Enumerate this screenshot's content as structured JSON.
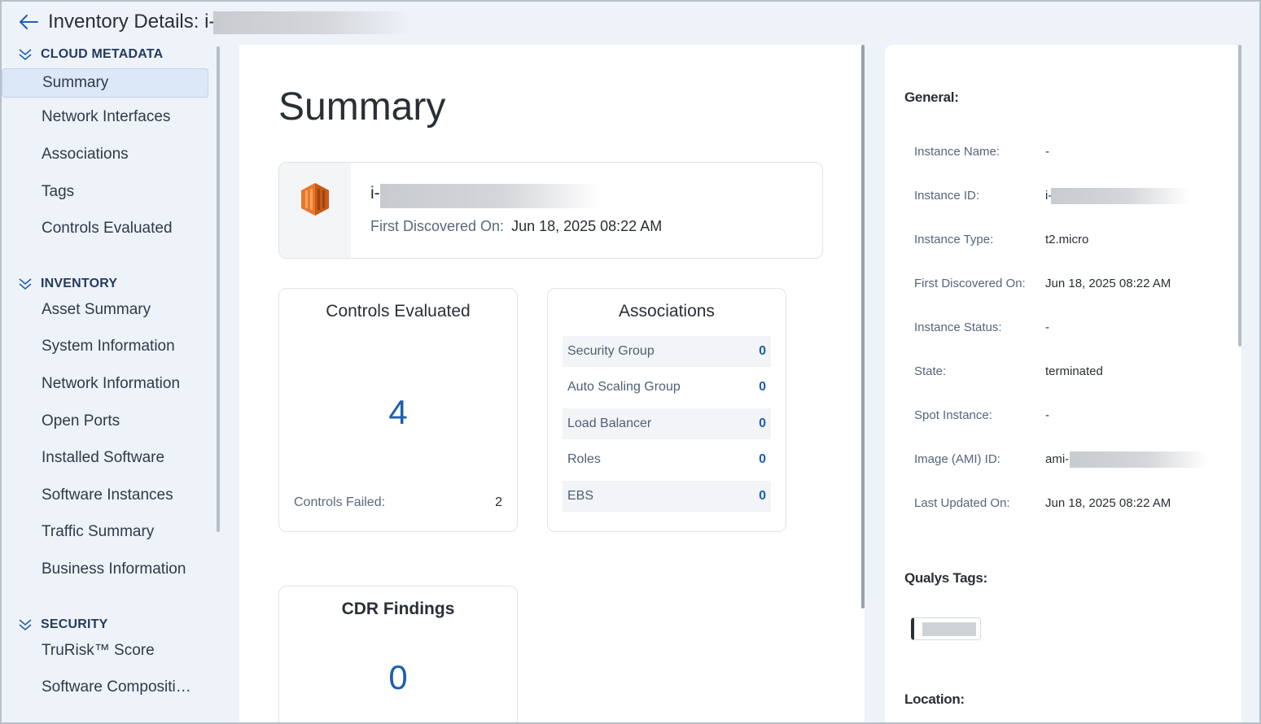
{
  "header": {
    "title": "Inventory Details: i-",
    "back_icon": "arrow-left-icon"
  },
  "sidebar": {
    "sections": [
      {
        "label": "CLOUD METADATA",
        "items": [
          "Summary",
          "Network Interfaces",
          "Associations",
          "Tags",
          "Controls Evaluated"
        ]
      },
      {
        "label": "INVENTORY",
        "items": [
          "Asset Summary",
          "System Information",
          "Network Information",
          "Open Ports",
          "Installed Software",
          "Software Instances",
          "Traffic Summary",
          "Business Information"
        ]
      },
      {
        "label": "SECURITY",
        "items": [
          "TruRisk™ Score",
          "Software Compositi…"
        ]
      }
    ],
    "active_item": "Summary"
  },
  "main": {
    "title": "Summary",
    "asset": {
      "id_prefix": "i-",
      "first_discovered_label": "First Discovered On:",
      "first_discovered_value": "Jun 18, 2025 08:22 AM",
      "icon": "aws-ec2-icon"
    },
    "controls_card": {
      "title": "Controls Evaluated",
      "count": "4",
      "failed_label": "Controls Failed:",
      "failed_value": "2"
    },
    "associations_card": {
      "title": "Associations",
      "rows": [
        {
          "label": "Security Group",
          "value": "0"
        },
        {
          "label": "Auto Scaling Group",
          "value": "0"
        },
        {
          "label": "Load Balancer",
          "value": "0"
        },
        {
          "label": "Roles",
          "value": "0"
        },
        {
          "label": "EBS",
          "value": "0"
        }
      ]
    },
    "cdr_card": {
      "title": "CDR Findings",
      "count": "0"
    }
  },
  "right": {
    "general_heading": "General:",
    "fields": [
      {
        "label": "Instance Name:",
        "value": "-"
      },
      {
        "label": "Instance ID:",
        "value": "i-"
      },
      {
        "label": "Instance Type:",
        "value": "t2.micro"
      },
      {
        "label": "First Discovered On:",
        "value": "Jun 18, 2025 08:22 AM"
      },
      {
        "label": "Instance Status:",
        "value": "-"
      },
      {
        "label": "State:",
        "value": "terminated"
      },
      {
        "label": "Spot Instance:",
        "value": "-"
      },
      {
        "label": "Image (AMI) ID:",
        "value": "ami-"
      },
      {
        "label": "Last Updated On:",
        "value": "Jun 18, 2025 08:22 AM"
      }
    ],
    "qualys_tags_heading": "Qualys Tags:",
    "location_heading": "Location:"
  },
  "colors": {
    "accent": "#1d5fae",
    "background": "#eef3fa",
    "aws_orange": "#e8772e"
  }
}
